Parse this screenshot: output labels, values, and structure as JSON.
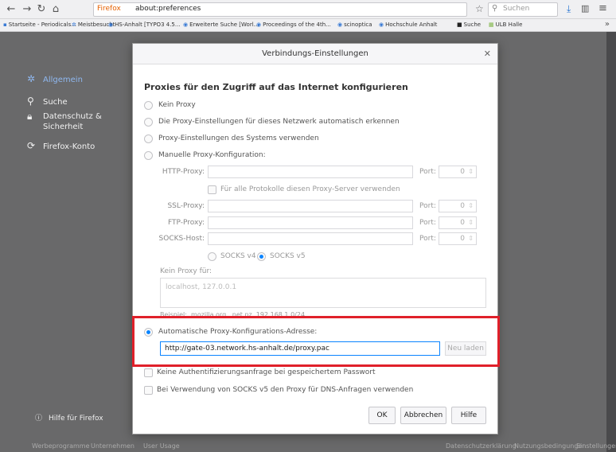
{
  "browser": {
    "brand_label": "Firefox",
    "url": "about:preferences",
    "search_placeholder": "Suchen",
    "bookmarks": [
      "Startseite - Periodicals...",
      "Meistbesucht",
      "HS-Anhalt [TYPO3 4.5...",
      "Erweiterte Suche [Worl...",
      "Proceedings of the 4th...",
      "scinoptica",
      "Hochschule Anhalt",
      "Suche",
      "ULB Halle"
    ]
  },
  "sidebar": {
    "items": [
      {
        "label": "Allgemein",
        "icon": "gear-icon"
      },
      {
        "label": "Suche",
        "icon": "search-icon"
      },
      {
        "label": "Datenschutz & Sicherheit",
        "icon": "lock-icon"
      },
      {
        "label": "Firefox-Konto",
        "icon": "sync-icon"
      }
    ],
    "help_label": "Hilfe für Firefox"
  },
  "footer_links": [
    "Werbeprogramme",
    "Unternehmen",
    "User Usage",
    "Datenschutzerklärung",
    "Nutzungsbedingungen",
    "Einstellungen"
  ],
  "dialog": {
    "title": "Verbindungs-Einstellungen",
    "heading": "Proxies für den Zugriff auf das Internet konfigurieren",
    "options": [
      "Kein Proxy",
      "Die Proxy-Einstellungen für dieses Netzwerk automatisch erkennen",
      "Proxy-Einstellungen des Systems verwenden",
      "Manuelle Proxy-Konfiguration:"
    ],
    "http_label": "HTTP-Proxy:",
    "port_label": "Port:",
    "port_value": "0",
    "all_protocols_label": "Für alle Protokolle diesen Proxy-Server verwenden",
    "ssl_label": "SSL-Proxy:",
    "ftp_label": "FTP-Proxy:",
    "socks_label": "SOCKS-Host:",
    "socks_v4": "SOCKS v4",
    "socks_v5": "SOCKS v5",
    "no_proxy_label": "Kein Proxy für:",
    "no_proxy_value": "localhost, 127.0.0.1",
    "example_text": "Beispiel: .mozilla.org, .net.nz, 192.168.1.0/24",
    "auto_config_label": "Automatische Proxy-Konfigurations-Adresse:",
    "auto_config_url": "http://gate-03.network.hs-anhalt.de/proxy.pac",
    "reload_label": "Neu laden",
    "no_auth_label": "Keine Authentifizierungsanfrage bei gespeichertem Passwort",
    "socks_dns_label": "Bei Verwendung von SOCKS v5 den Proxy für DNS-Anfragen verwenden",
    "ok_label": "OK",
    "cancel_label": "Abbrechen",
    "help_label": "Hilfe"
  }
}
